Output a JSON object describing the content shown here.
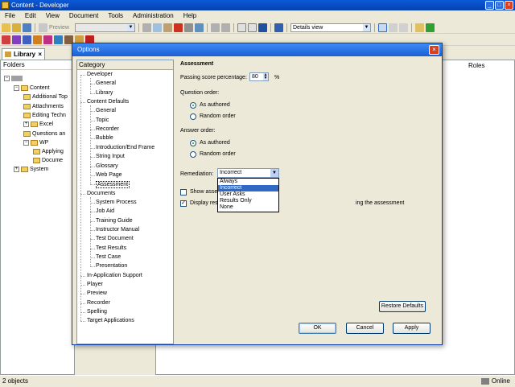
{
  "app": {
    "title": "Content - Developer"
  },
  "menu": [
    "File",
    "Edit",
    "View",
    "Document",
    "Tools",
    "Administration",
    "Help"
  ],
  "toolbar": {
    "preview_label": "Preview",
    "view_select": "Details view"
  },
  "library": {
    "tab_label": "Library",
    "folders_header": "Folders",
    "roles_header": "Roles",
    "tree": [
      {
        "label": "Content"
      },
      {
        "label": "Additional Top"
      },
      {
        "label": "Attachments"
      },
      {
        "label": "Editing Techn"
      },
      {
        "label": "Excel"
      },
      {
        "label": "Questions an"
      },
      {
        "label": "WP"
      },
      {
        "label": "Applying"
      },
      {
        "label": "Docume"
      },
      {
        "label": "System"
      }
    ]
  },
  "status": {
    "left": "2 objects",
    "right": "Online"
  },
  "dialog": {
    "title": "Options",
    "close": "×",
    "category_header": "Category",
    "categories": [
      "Developer",
      "General",
      "Library",
      "Content Defaults",
      "General",
      "Topic",
      "Recorder",
      "Bubble",
      "Introduction/End Frame",
      "String Input",
      "Glossary",
      "Web Page",
      "Assessment",
      "Documents",
      "System Process",
      "Job Aid",
      "Training Guide",
      "Instructor Manual",
      "Test Document",
      "Test Results",
      "Test Case",
      "Presentation",
      "In-Application Support",
      "Player",
      "Preview",
      "Recorder",
      "Spelling",
      "Target Applications"
    ],
    "section_title": "Assessment",
    "passing_label": "Passing score percentage:",
    "passing_value": "80",
    "percent": "%",
    "question_order_label": "Question order:",
    "question_order_options": [
      "As authored",
      "Random order"
    ],
    "answer_order_label": "Answer order:",
    "answer_order_options": [
      "As authored",
      "Random order"
    ],
    "remediation_label": "Remediation:",
    "remediation_value": "Incorrect",
    "remediation_options": [
      "Always",
      "Incorrect",
      "User Asks",
      "Results Only",
      "None"
    ],
    "show_label": "Show asse",
    "display_label": "Display res",
    "display_suffix": "ing the assessment",
    "restore_button": "Restore Defaults",
    "ok_button": "OK",
    "cancel_button": "Cancel",
    "apply_button": "Apply"
  }
}
